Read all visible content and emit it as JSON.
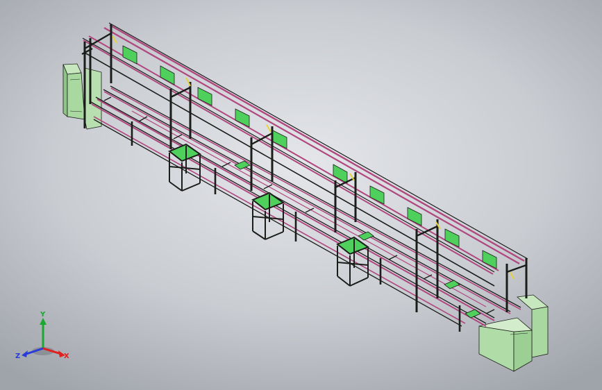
{
  "triad": {
    "x_label": "X",
    "y_label": "Y",
    "z_label": "Z",
    "x_color": "#e0201c",
    "y_color": "#1aa830",
    "z_color": "#2a3cd8"
  },
  "colors": {
    "background_center": "#e4e6ea",
    "background_edge": "#9fa3aa",
    "frame": "#1b1d1a",
    "rail": "#b0477e",
    "cabinet": "#a9d9a0",
    "panel": "#4fd05c"
  }
}
